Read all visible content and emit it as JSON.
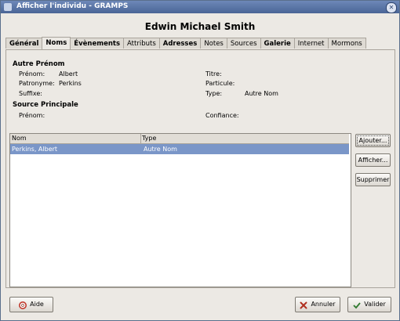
{
  "window": {
    "title": "Afficher l'individu - GRAMPS"
  },
  "person": {
    "name": "Edwin Michael Smith"
  },
  "tabs": [
    {
      "label": "Général"
    },
    {
      "label": "Noms"
    },
    {
      "label": "Évènements"
    },
    {
      "label": "Attributs"
    },
    {
      "label": "Adresses"
    },
    {
      "label": "Notes"
    },
    {
      "label": "Sources"
    },
    {
      "label": "Galerie"
    },
    {
      "label": "Internet"
    },
    {
      "label": "Mormons"
    }
  ],
  "alt_name": {
    "section_title": "Autre Prénom",
    "prenom_label": "Prénom:",
    "prenom_value": "Albert",
    "patronyme_label": "Patronyme:",
    "patronyme_value": "Perkins",
    "suffixe_label": "Suffixe:",
    "suffixe_value": "",
    "titre_label": "Titre:",
    "titre_value": "",
    "particule_label": "Particule:",
    "particule_value": "",
    "type_label": "Type:",
    "type_value": "Autre Nom"
  },
  "source": {
    "section_title": "Source Principale",
    "prenom_label": "Prénom:",
    "prenom_value": "",
    "confiance_label": "Confiance:",
    "confiance_value": ""
  },
  "list": {
    "columns": [
      "Nom",
      "Type"
    ],
    "rows": [
      {
        "nom": "Perkins, Albert",
        "type": "Autre Nom"
      }
    ]
  },
  "side_buttons": {
    "ajouter": "Ajouter...",
    "afficher": "Afficher...",
    "supprimer": "Supprimer"
  },
  "bottom_buttons": {
    "aide": "Aide",
    "annuler": "Annuler",
    "valider": "Valider"
  }
}
